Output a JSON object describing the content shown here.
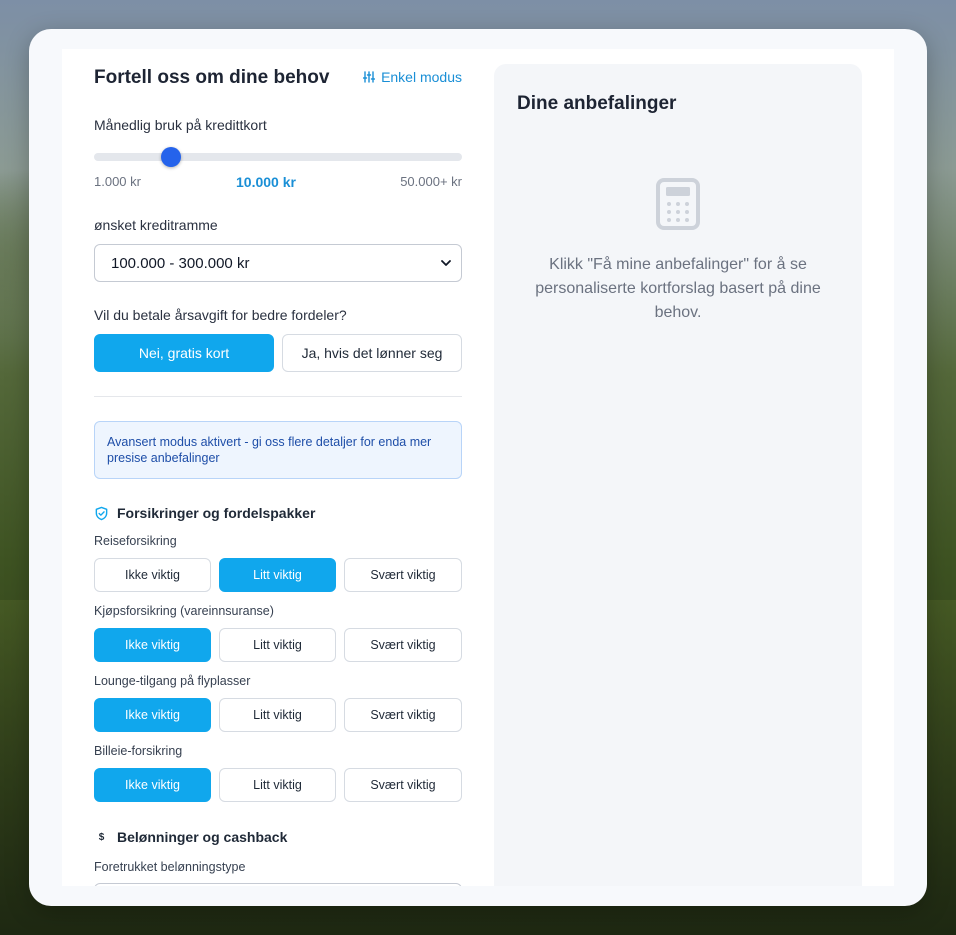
{
  "form": {
    "title": "Fortell oss om dine behov",
    "mode_toggle": "Enkel modus",
    "spend": {
      "label": "Månedlig bruk på kredittkort",
      "min": "1.000 kr",
      "current": "10.000 kr",
      "max": "50.000+ kr",
      "level_fraction": 0.2
    },
    "credit": {
      "label": "ønsket kreditramme",
      "selected": "100.000 - 300.000 kr"
    },
    "fee": {
      "label": "Vil du betale årsavgift for bedre fordeler?",
      "opt_no": "Nei, gratis kort",
      "opt_yes": "Ja, hvis det lønner seg",
      "selected": "no"
    },
    "notice": "Avansert modus aktivert - gi oss flere detaljer for enda mer presise anbefalinger",
    "insurance": {
      "heading": "Forsikringer og fordelspakker",
      "icon": "shield-check-icon",
      "options": [
        "Ikke viktig",
        "Litt viktig",
        "Svært viktig"
      ],
      "rows": [
        {
          "label": "Reiseforsikring",
          "selected": 1
        },
        {
          "label": "Kjøpsforsikring (vareinnsuranse)",
          "selected": 0
        },
        {
          "label": "Lounge-tilgang på flyplasser",
          "selected": 0
        },
        {
          "label": "Billeie-forsikring",
          "selected": 0
        }
      ]
    },
    "rewards": {
      "heading": "Belønninger og cashback",
      "icon": "dollar-icon",
      "icon_glyph": "$",
      "sub": "Foretrukket belønningstype"
    }
  },
  "results": {
    "title": "Dine anbefalinger",
    "icon": "calculator-icon",
    "message": "Klikk \"Få mine anbefalinger\" for å se personaliserte kortforslag basert på dine behov."
  },
  "colors": {
    "accent": "#10a7ed",
    "link": "#1a8fd6",
    "slider_thumb": "#2563eb"
  }
}
